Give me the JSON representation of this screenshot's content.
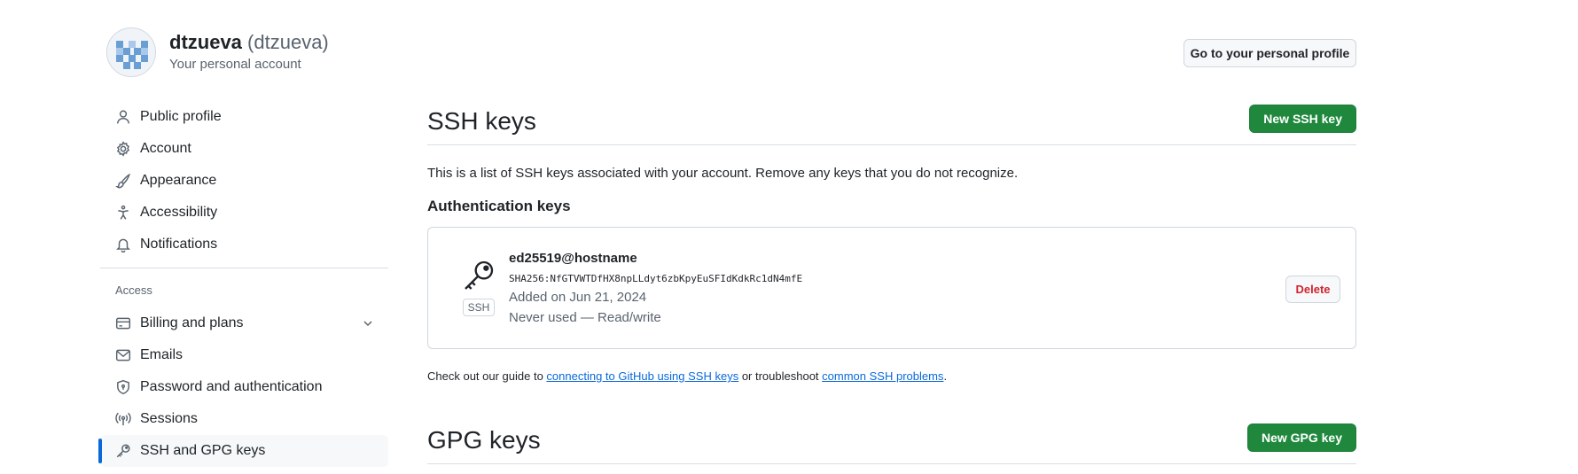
{
  "account": {
    "username": "dtzueva",
    "login": "(dtzueva)",
    "subtitle": "Your personal account",
    "profile_button": "Go to your personal profile"
  },
  "sidebar": {
    "top_items": [
      {
        "label": "Public profile",
        "icon": "person-icon"
      },
      {
        "label": "Account",
        "icon": "gear-icon"
      },
      {
        "label": "Appearance",
        "icon": "paintbrush-icon"
      },
      {
        "label": "Accessibility",
        "icon": "accessibility-icon"
      },
      {
        "label": "Notifications",
        "icon": "bell-icon"
      }
    ],
    "access_heading": "Access",
    "access_items": [
      {
        "label": "Billing and plans",
        "icon": "credit-card-icon",
        "expandable": true
      },
      {
        "label": "Emails",
        "icon": "mail-icon"
      },
      {
        "label": "Password and authentication",
        "icon": "shield-lock-icon"
      },
      {
        "label": "Sessions",
        "icon": "broadcast-icon"
      },
      {
        "label": "SSH and GPG keys",
        "icon": "key-icon",
        "active": true
      }
    ]
  },
  "ssh": {
    "title": "SSH keys",
    "new_button": "New SSH key",
    "intro": "This is a list of SSH keys associated with your account. Remove any keys that you do not recognize.",
    "auth_heading": "Authentication keys",
    "key": {
      "name": "ed25519@hostname",
      "fingerprint": "SHA256:NfGTVWTDfHX8npLLdyt6zbKpyEuSFIdKdkRc1dN4mfE",
      "added": "Added on Jun 21, 2024",
      "usage": "Never used — Read/write",
      "badge": "SSH",
      "delete_button": "Delete"
    },
    "guide": {
      "prefix": "Check out our guide to ",
      "link1": "connecting to GitHub using SSH keys",
      "middle": " or troubleshoot ",
      "link2": "common SSH problems",
      "suffix": "."
    }
  },
  "gpg": {
    "title": "GPG keys",
    "new_button": "New GPG key"
  },
  "colors": {
    "accent": "#0969da",
    "primary_button": "#1f883d",
    "danger": "#d1242f"
  }
}
